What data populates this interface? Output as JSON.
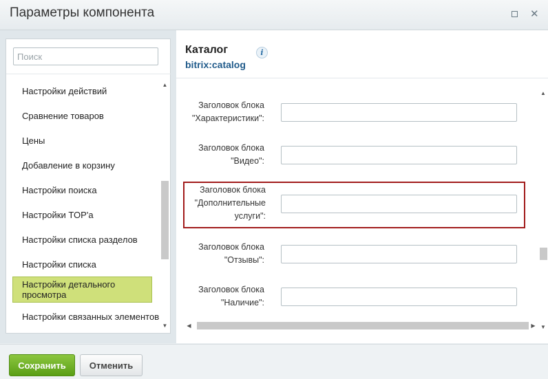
{
  "window": {
    "title": "Параметры компонента"
  },
  "sidebar": {
    "search_placeholder": "Поиск",
    "items": [
      {
        "label": "Настройки действий"
      },
      {
        "label": "Сравнение товаров"
      },
      {
        "label": "Цены"
      },
      {
        "label": "Добавление в корзину"
      },
      {
        "label": "Настройки поиска"
      },
      {
        "label": "Настройки TOP'а"
      },
      {
        "label": "Настройки списка разделов"
      },
      {
        "label": "Настройки списка"
      },
      {
        "label": "Настройки детального просмотра",
        "active": true
      },
      {
        "label": "Настройки связанных элементов"
      }
    ]
  },
  "component": {
    "title": "Каталог",
    "code": "bitrix:catalog"
  },
  "fields": [
    {
      "label_line1": "Заголовок блока",
      "label_line2": "\"Характеристики\":",
      "label_line3": "",
      "value": ""
    },
    {
      "label_line1": "Заголовок блока",
      "label_line2": "\"Видео\":",
      "label_line3": "",
      "value": ""
    },
    {
      "label_line1": "Заголовок блока",
      "label_line2": "\"Дополнительные",
      "label_line3": "услуги\":",
      "value": "",
      "highlighted": true
    },
    {
      "label_line1": "Заголовок блока",
      "label_line2": "\"Отзывы\":",
      "label_line3": "",
      "value": ""
    },
    {
      "label_line1": "Заголовок блока",
      "label_line2": "\"Наличие\":",
      "label_line3": "",
      "value": ""
    }
  ],
  "footer": {
    "save_label": "Сохранить",
    "cancel_label": "Отменить"
  },
  "colors": {
    "save_button": "#6aaf1e",
    "active_item": "#cfe07a",
    "highlight_border": "#a11a1a",
    "component_code": "#1f5a8a"
  }
}
